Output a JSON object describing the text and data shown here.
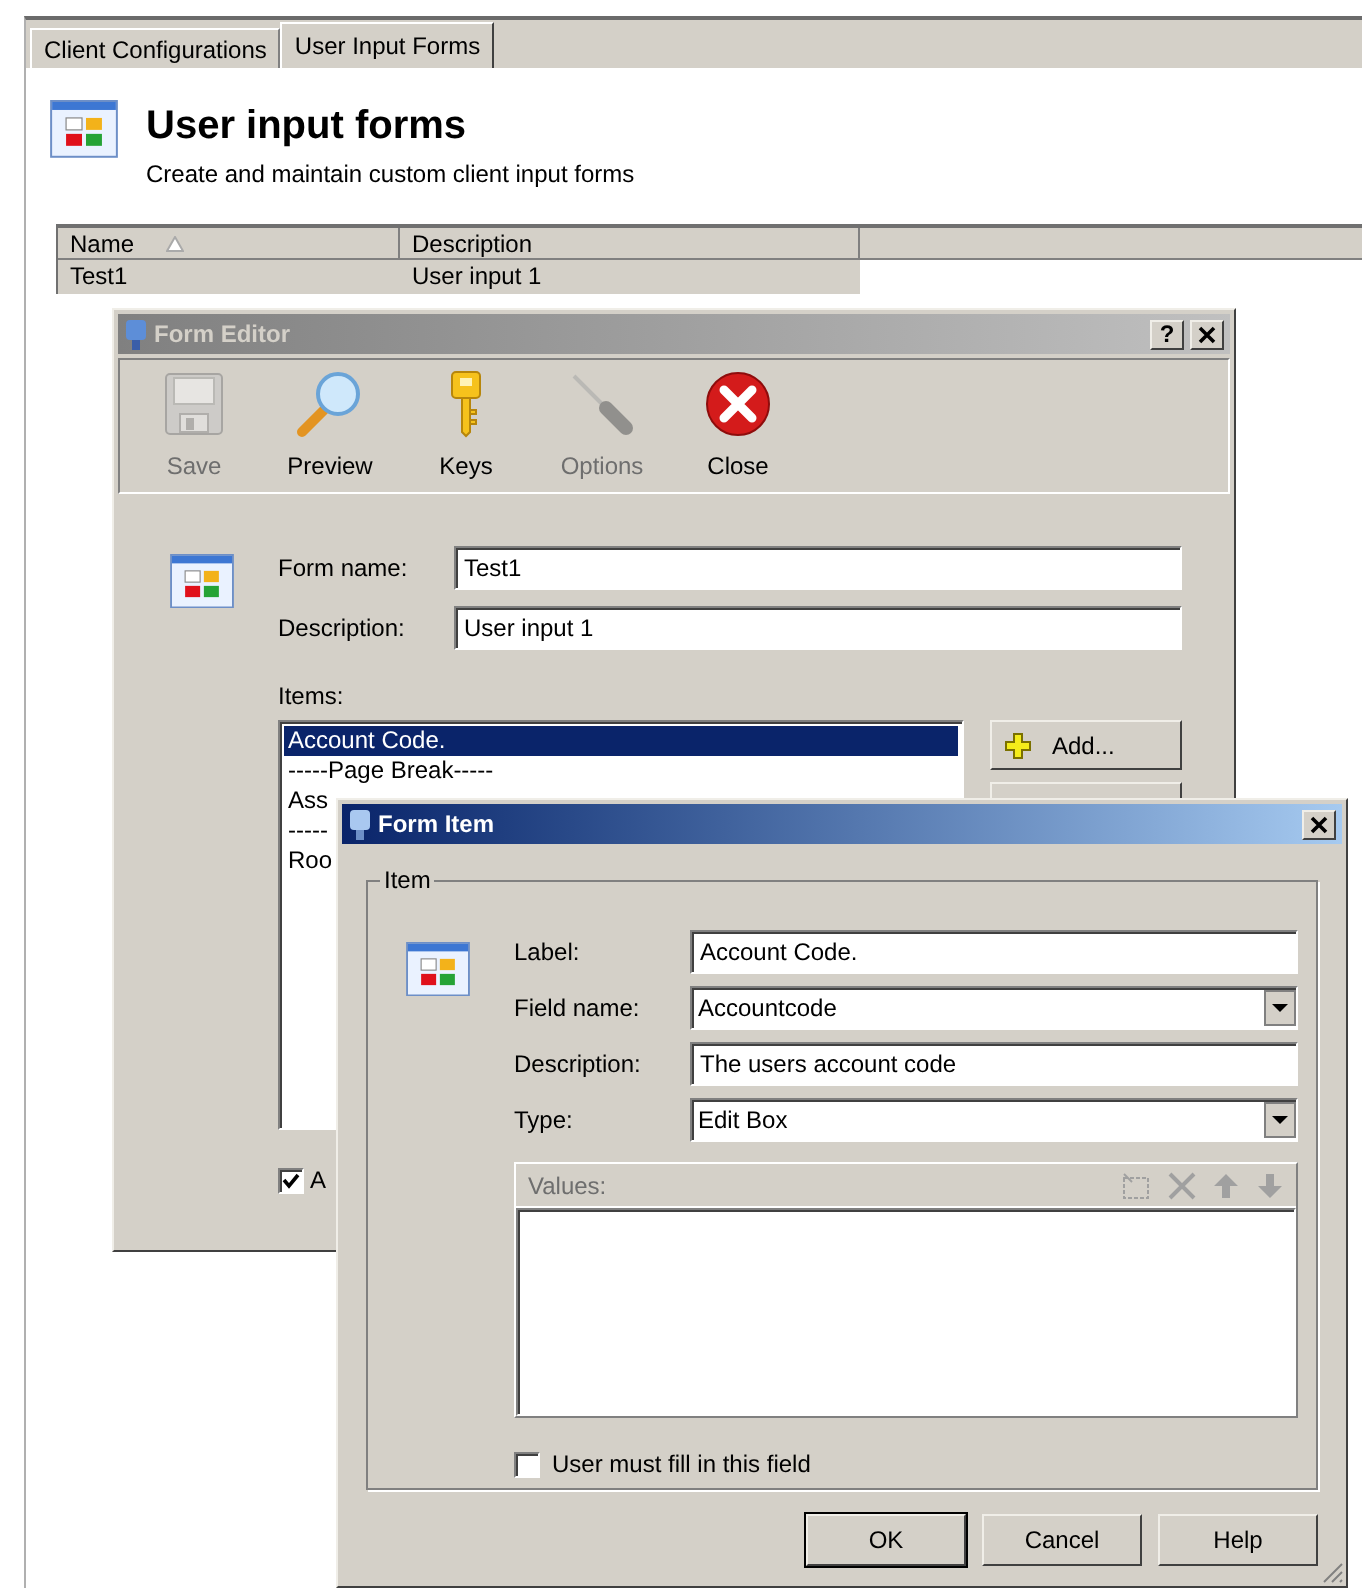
{
  "tabs": [
    {
      "label": "Client Configurations",
      "selected": false
    },
    {
      "label": "User Input Forms",
      "selected": true
    }
  ],
  "header": {
    "title": "User input forms",
    "subtitle": "Create and maintain custom client input forms"
  },
  "table": {
    "columns": [
      {
        "label": "Name",
        "sorted": true
      },
      {
        "label": "Description",
        "sorted": false
      }
    ],
    "rows": [
      {
        "cells": [
          "Test1",
          "User input 1"
        ],
        "selected": true
      }
    ]
  },
  "form_editor": {
    "title": "Form Editor",
    "active": false,
    "help_label": "?",
    "toolbar": [
      {
        "kind": "save",
        "label": "Save",
        "disabled": true
      },
      {
        "kind": "preview",
        "label": "Preview",
        "disabled": false
      },
      {
        "kind": "keys",
        "label": "Keys",
        "disabled": false
      },
      {
        "kind": "options",
        "label": "Options",
        "disabled": true
      },
      {
        "kind": "close",
        "label": "Close",
        "disabled": false
      }
    ],
    "fields": [
      {
        "label": "Form name:",
        "value": "Test1"
      },
      {
        "label": "Description:",
        "value": "User input 1"
      }
    ],
    "items_label": "Items:",
    "items": [
      {
        "text": "Account Code.",
        "selected": true
      },
      {
        "text": "-----Page Break-----",
        "selected": false
      },
      {
        "text": "Ass",
        "selected": false
      },
      {
        "text": "-----",
        "selected": false
      },
      {
        "text": "Roo",
        "selected": false
      }
    ],
    "add_button": "Add...",
    "checkbox": {
      "label": "A",
      "checked": true
    }
  },
  "form_item": {
    "title": "Form Item",
    "active": true,
    "group_title": "Item",
    "fields": [
      {
        "kind": "text",
        "label": "Label:",
        "value": "Account Code."
      },
      {
        "kind": "dropdown",
        "label": "Field name:",
        "value": "Accountcode"
      },
      {
        "kind": "text",
        "label": "Description:",
        "value": "The users account code"
      },
      {
        "kind": "dropdown",
        "label": "Type:",
        "value": "Edit Box"
      }
    ],
    "values_label": "Values:",
    "values_disabled": true,
    "required_checkbox": {
      "label": "User must fill in this field",
      "checked": false
    },
    "buttons": [
      {
        "label": "OK",
        "default": true
      },
      {
        "label": "Cancel",
        "default": false
      },
      {
        "label": "Help",
        "default": false
      }
    ]
  }
}
